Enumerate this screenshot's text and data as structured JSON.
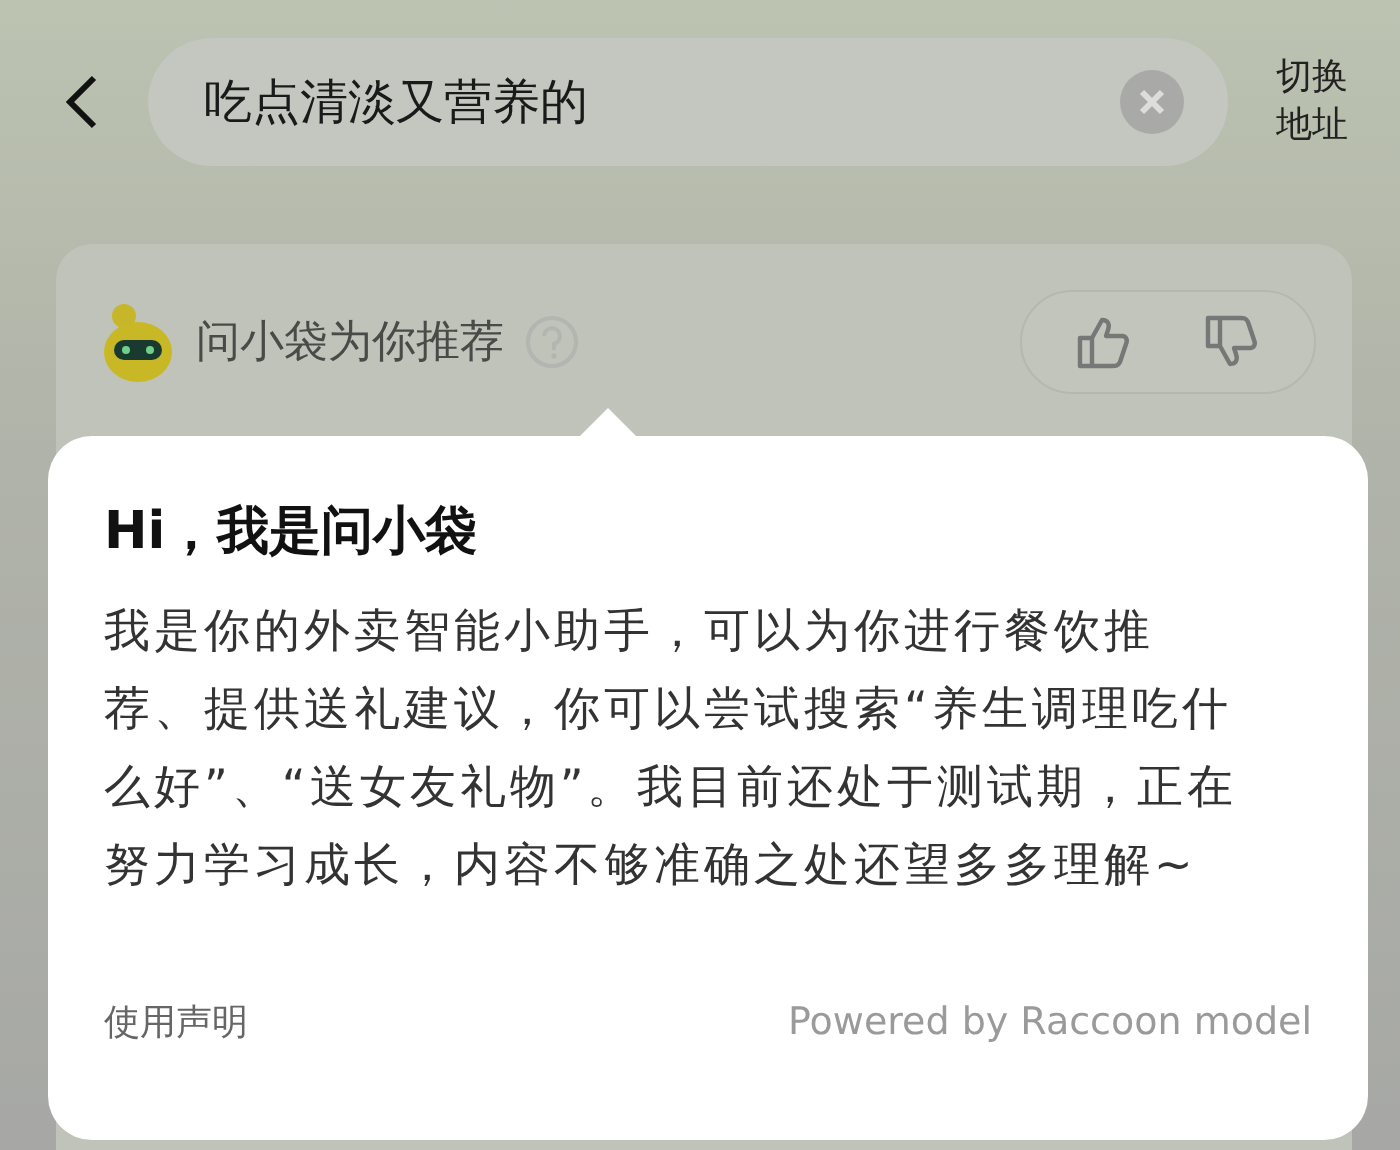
{
  "search": {
    "value": "吃点清淡又营养的",
    "switch_address": "切换地址"
  },
  "recommend": {
    "title": "问小袋为你推荐"
  },
  "popup": {
    "title": "Hi，我是问小袋",
    "body": "我是你的外卖智能小助手，可以为你进行餐饮推荐、提供送礼建议，你可以尝试搜索“养生调理吃什么好”、“送女友礼物”。我目前还处于测试期，正在努力学习成长，内容不够准确之处还望多多理解~",
    "footer_link": "使用声明",
    "powered_by": "Powered by Raccoon model"
  }
}
